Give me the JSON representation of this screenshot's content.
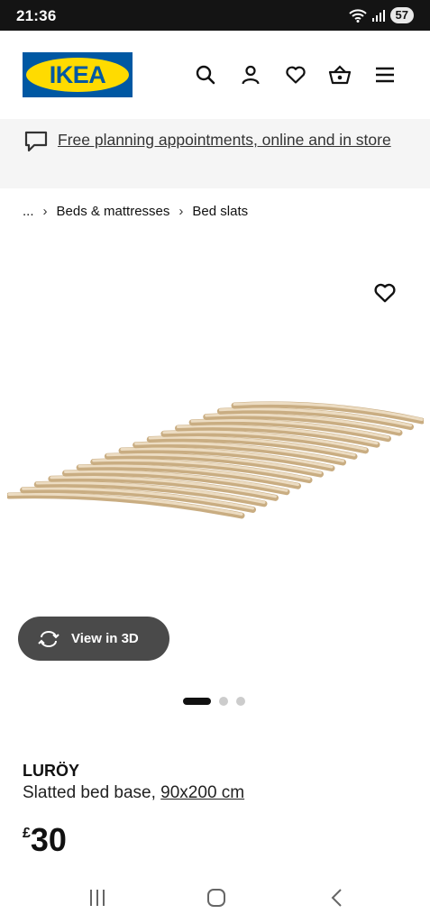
{
  "status_bar": {
    "time": "21:36",
    "battery": "57"
  },
  "header": {
    "logo_text": "IKEA",
    "icons": [
      "search-icon",
      "profile-icon",
      "heart-icon",
      "basket-icon",
      "menu-icon"
    ]
  },
  "promo": {
    "text": "Free planning appointments, online and in store"
  },
  "breadcrumb": {
    "ellipsis": "...",
    "items": [
      "Beds & mattresses",
      "Bed slats"
    ]
  },
  "gallery": {
    "view_3d_label": "View in 3D",
    "page_count": 3,
    "active_page": 1
  },
  "product": {
    "name": "LURÖY",
    "description": "Slatted bed base, ",
    "size": "90x200 cm",
    "currency": "£",
    "price": "30"
  },
  "colors": {
    "ikea_blue": "#0058a3",
    "ikea_yellow": "#ffdb00",
    "button_dark": "#4a4a4a"
  }
}
